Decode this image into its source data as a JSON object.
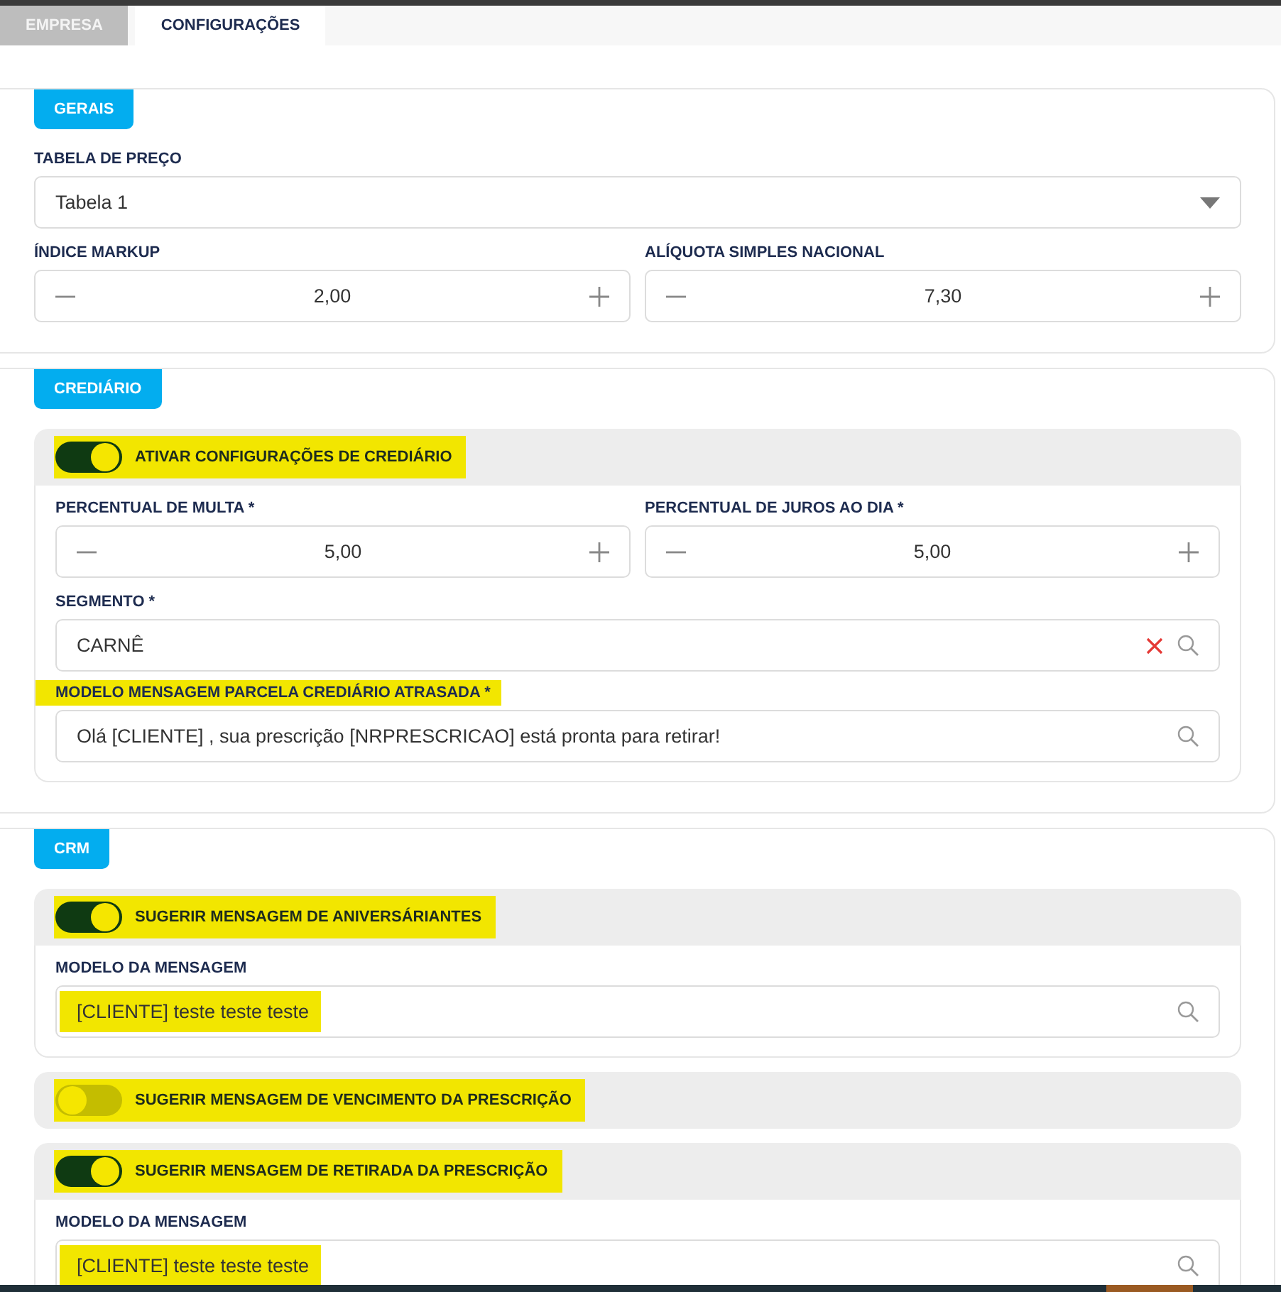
{
  "tabs": [
    {
      "label": "EMPRESA",
      "selected": false
    },
    {
      "label": "CONFIGURAÇÕES",
      "selected": true
    }
  ],
  "sections": [
    {
      "title": "GERAIS",
      "blocks": [
        {
          "kind": "fields",
          "fields": [
            {
              "kind": "select",
              "label": "TABELA DE PREÇO",
              "value": "Tabela 1"
            }
          ]
        },
        {
          "kind": "fields",
          "fields": [
            {
              "kind": "stepper",
              "label": "ÍNDICE MARKUP",
              "value": "2,00"
            },
            {
              "kind": "stepper",
              "label": "ALÍQUOTA SIMPLES NACIONAL",
              "value": "7,30"
            }
          ]
        }
      ]
    },
    {
      "title": "CREDIÁRIO",
      "blocks": [
        {
          "kind": "toggle",
          "label": "ATIVAR CONFIGURAÇÕES DE CREDIÁRIO",
          "on": true,
          "highlighted": true,
          "rows": [
            {
              "fields": [
                {
                  "kind": "stepper",
                  "label": "PERCENTUAL DE MULTA *",
                  "value": "5,00"
                },
                {
                  "kind": "stepper",
                  "label": "PERCENTUAL DE JUROS AO DIA *",
                  "value": "5,00"
                }
              ]
            },
            {
              "fields": [
                {
                  "kind": "search",
                  "label": "SEGMENTO *",
                  "value": "CARNÊ",
                  "clearable": true
                }
              ]
            },
            {
              "fields": [
                {
                  "kind": "search",
                  "label": "MODELO MENSAGEM PARCELA CREDIÁRIO ATRASADA *",
                  "label_highlighted": true,
                  "value": "Olá [CLIENTE] , sua prescrição [NRPRESCRICAO] está pronta para retirar!"
                }
              ]
            }
          ]
        }
      ]
    },
    {
      "title": "CRM",
      "blocks": [
        {
          "kind": "toggle",
          "label": "SUGERIR MENSAGEM DE ANIVERSÁRIANTES",
          "on": true,
          "highlighted": true,
          "rows": [
            {
              "fields": [
                {
                  "kind": "search",
                  "label": "MODELO DA MENSAGEM",
                  "value": "[CLIENTE] teste teste teste",
                  "value_highlighted": true
                }
              ]
            }
          ]
        },
        {
          "kind": "toggle",
          "label": "SUGERIR MENSAGEM DE VENCIMENTO DA PRESCRIÇÃO",
          "on": false,
          "highlighted": true
        },
        {
          "kind": "toggle",
          "label": "SUGERIR MENSAGEM DE RETIRADA DA PRESCRIÇÃO",
          "on": true,
          "highlighted": true,
          "rows": [
            {
              "fields": [
                {
                  "kind": "search",
                  "label": "MODELO DA MENSAGEM",
                  "value": "[CLIENTE] teste teste teste",
                  "value_highlighted": true
                }
              ]
            }
          ]
        }
      ]
    }
  ]
}
